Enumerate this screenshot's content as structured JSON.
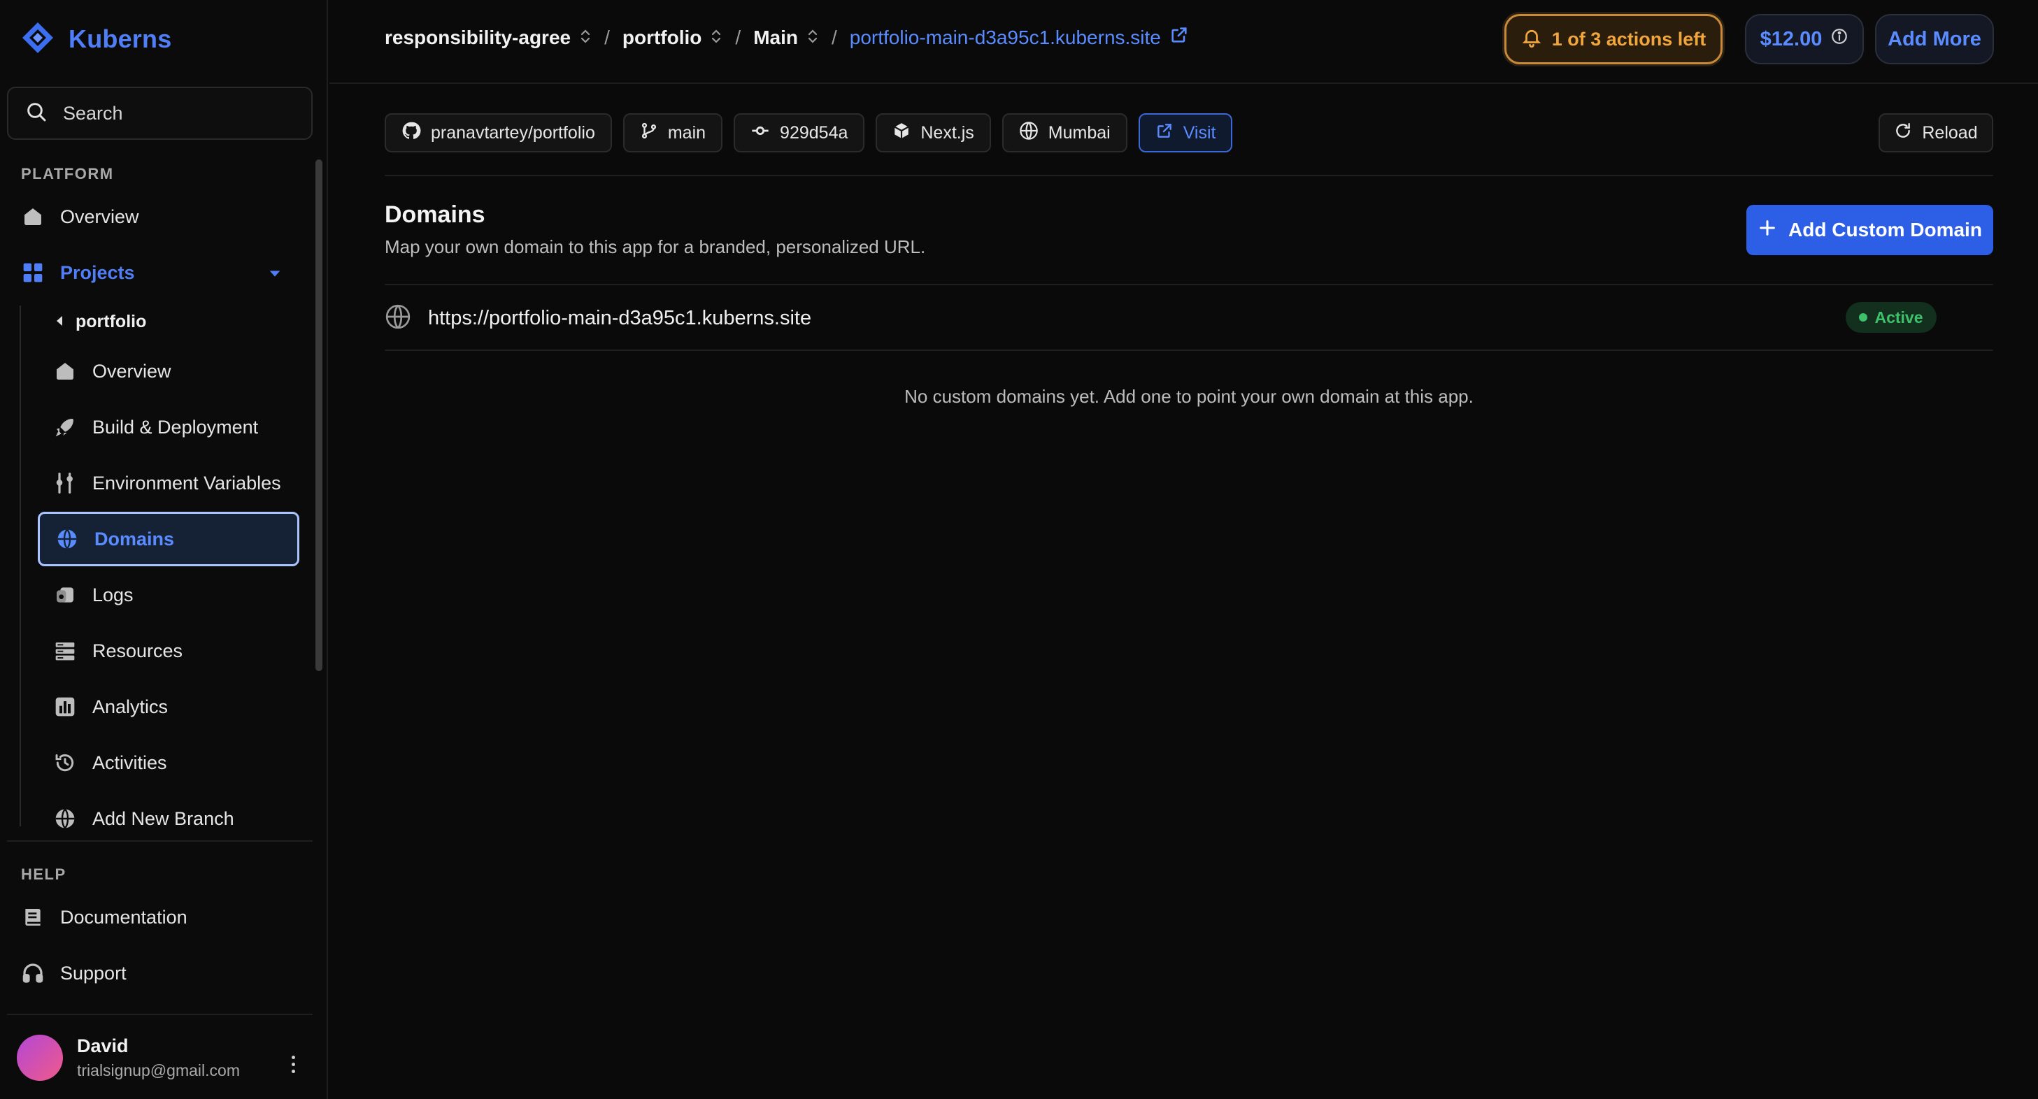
{
  "brand": {
    "name": "Kuberns",
    "color": "#4f7ef7"
  },
  "search": {
    "placeholder": "Search"
  },
  "sidebar": {
    "platform_label": "PLATFORM",
    "overview": "Overview",
    "projects": "Projects",
    "project_name": "portfolio",
    "project_items": [
      {
        "label": "Overview",
        "icon": "home-icon"
      },
      {
        "label": "Build & Deployment",
        "icon": "rocket-icon"
      },
      {
        "label": "Environment Variables",
        "icon": "sliders-icon"
      },
      {
        "label": "Domains",
        "icon": "globe-icon",
        "active": true
      },
      {
        "label": "Logs",
        "icon": "logs-icon"
      },
      {
        "label": "Resources",
        "icon": "server-icon"
      },
      {
        "label": "Analytics",
        "icon": "bar-chart-icon"
      },
      {
        "label": "Activities",
        "icon": "history-icon"
      },
      {
        "label": "Add New Branch",
        "icon": "globe-icon"
      }
    ],
    "help_label": "HELP",
    "documentation": "Documentation",
    "support": "Support"
  },
  "user": {
    "name": "David",
    "email": "trialsignup@gmail.com"
  },
  "breadcrumb": {
    "workspace": "responsibility-agree",
    "project": "portfolio",
    "branch": "Main",
    "site": "portfolio-main-d3a95c1.kuberns.site"
  },
  "header": {
    "actions_left": "1 of 3 actions left",
    "credit": "$12.00",
    "add_more": "Add More"
  },
  "chips": {
    "repo": "pranavtartey/portfolio",
    "branch": "main",
    "commit": "929d54a",
    "framework": "Next.js",
    "region": "Mumbai",
    "visit": "Visit",
    "reload": "Reload"
  },
  "domains": {
    "title": "Domains",
    "subtitle": "Map your own domain to this app for a branded, personalized URL.",
    "add_button": "Add Custom Domain",
    "items": [
      {
        "url": "https://portfolio-main-d3a95c1.kuberns.site",
        "status": "Active"
      }
    ],
    "empty_message": "No custom domains yet. Add one to point your own domain at this app."
  },
  "colors": {
    "accent": "#4f7ef7",
    "warning": "#f0a53d",
    "success": "#3fc06a",
    "background": "#0a0a0a"
  }
}
